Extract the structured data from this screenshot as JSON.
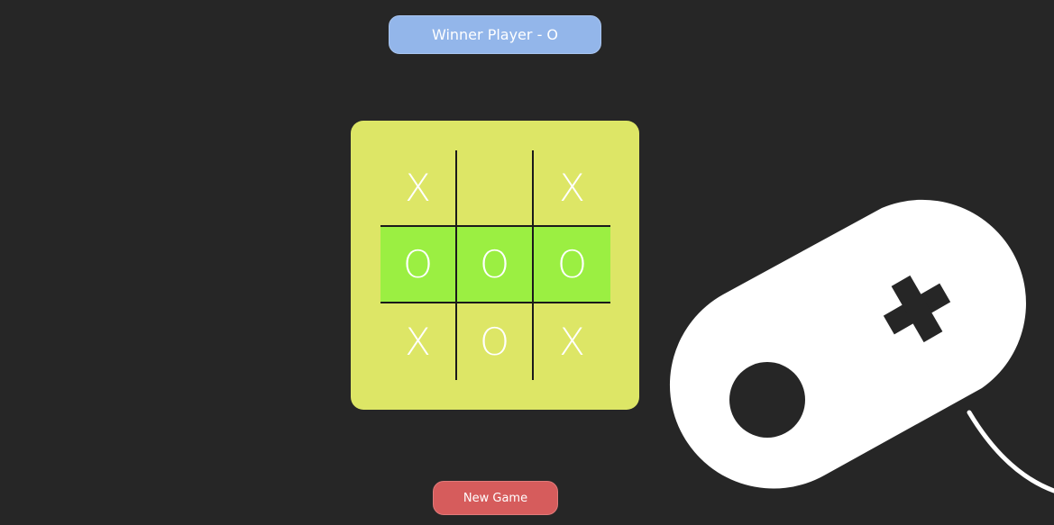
{
  "status": {
    "text": "Winner Player - O"
  },
  "board": {
    "cells": [
      "X",
      "",
      "X",
      "O",
      "O",
      "O",
      "X",
      "O",
      "X"
    ],
    "winning_cells": [
      3,
      4,
      5
    ]
  },
  "actions": {
    "new_game_label": "New Game"
  },
  "decoration": {
    "icon": "game-controller-icon"
  },
  "colors": {
    "background": "#262626",
    "status_badge": "#93b6ea",
    "board": "#dde666",
    "win_highlight": "#9bef42",
    "new_game_button": "#d65c5c"
  }
}
